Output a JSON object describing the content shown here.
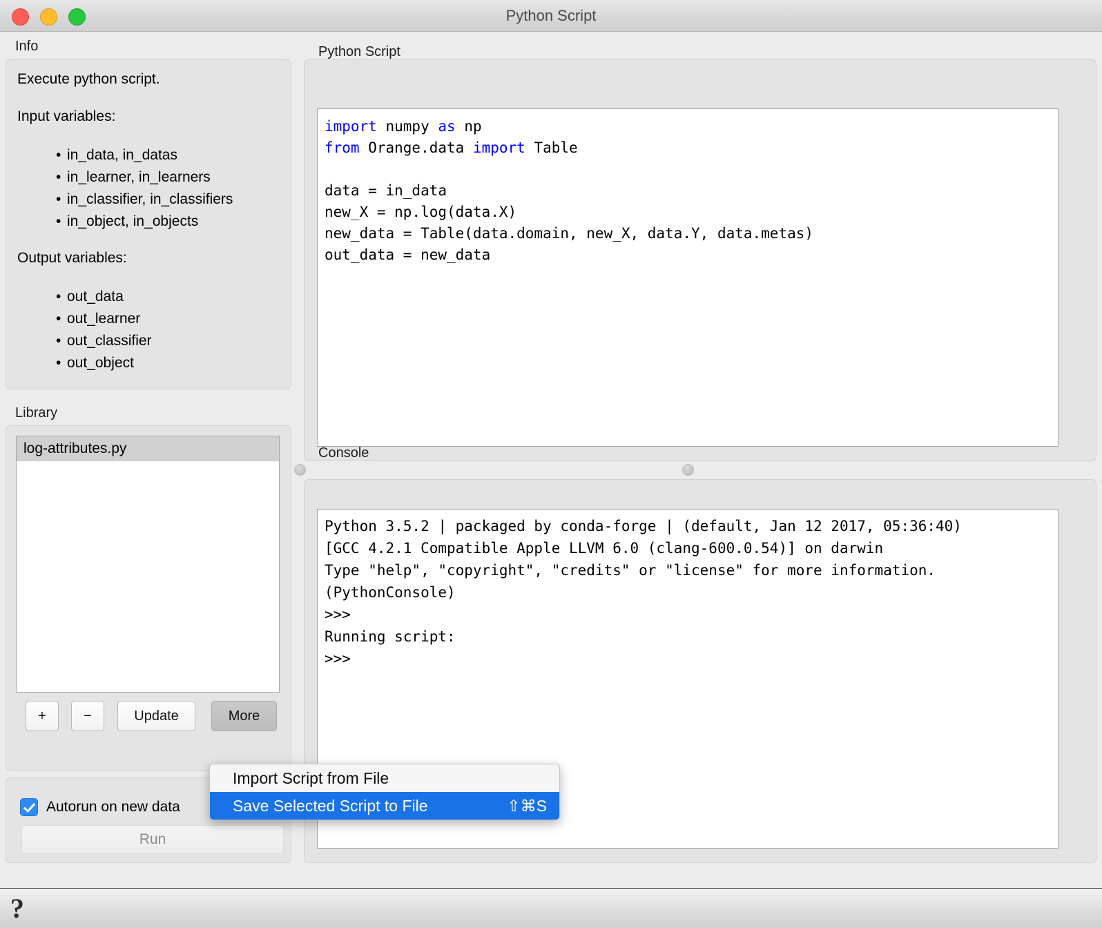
{
  "window": {
    "title": "Python Script",
    "traffic_lights": {
      "close": "close-button",
      "minimize": "minimize-button",
      "zoom": "zoom-button"
    },
    "colors": {
      "close": "#ff5f57",
      "minimize": "#febc2e",
      "zoom": "#28c840",
      "menu_highlight": "#1a72e8",
      "checkbox_accent": "#2e8bf5",
      "keyword": "#0000ff"
    }
  },
  "info": {
    "caption": "Info",
    "description": "Execute python script.",
    "input_heading": "Input variables:",
    "input_variables": [
      "in_data, in_datas",
      "in_learner, in_learners",
      "in_classifier, in_classifiers",
      "in_object, in_objects"
    ],
    "output_heading": "Output variables:",
    "output_variables": [
      "out_data",
      "out_learner",
      "out_classifier",
      "out_object"
    ]
  },
  "library": {
    "caption": "Library",
    "items": [
      {
        "name": "log-attributes.py",
        "selected": true
      }
    ],
    "buttons": {
      "add": "+",
      "remove": "−",
      "update": "Update",
      "more": "More"
    }
  },
  "more_menu": {
    "items": [
      {
        "label": "Import Script from File",
        "shortcut": "",
        "highlighted": false
      },
      {
        "label": "Save Selected Script to File",
        "shortcut": "⇧⌘S",
        "highlighted": true
      }
    ]
  },
  "run_panel": {
    "autorun_label": "Autorun on new data",
    "autorun_checked": true,
    "run_label": "Run",
    "run_enabled": false
  },
  "script_panel": {
    "caption": "Python Script",
    "code_lines": [
      {
        "segments": [
          {
            "t": "import",
            "kw": true
          },
          {
            "t": " numpy ",
            "kw": false
          },
          {
            "t": "as",
            "kw": true
          },
          {
            "t": " np",
            "kw": false
          }
        ]
      },
      {
        "segments": [
          {
            "t": "from",
            "kw": true
          },
          {
            "t": " Orange.data ",
            "kw": false
          },
          {
            "t": "import",
            "kw": true
          },
          {
            "t": " Table",
            "kw": false
          }
        ]
      },
      {
        "segments": [
          {
            "t": "",
            "kw": false
          }
        ]
      },
      {
        "segments": [
          {
            "t": "data = in_data",
            "kw": false
          }
        ]
      },
      {
        "segments": [
          {
            "t": "new_X = np.log(data.X)",
            "kw": false
          }
        ]
      },
      {
        "segments": [
          {
            "t": "new_data = Table(data.domain, new_X, data.Y, data.metas)",
            "kw": false
          }
        ]
      },
      {
        "segments": [
          {
            "t": "out_data = new_data",
            "kw": false
          }
        ]
      }
    ]
  },
  "console_panel": {
    "caption": "Console",
    "lines": [
      "Python 3.5.2 | packaged by conda-forge | (default, Jan 12 2017, 05:36:40)",
      "[GCC 4.2.1 Compatible Apple LLVM 6.0 (clang-600.0.54)] on darwin",
      "Type \"help\", \"copyright\", \"credits\" or \"license\" for more information.",
      "(PythonConsole)",
      ">>>",
      "Running script:",
      ">>>"
    ]
  },
  "status_bar": {
    "help_icon_glyph": "?"
  }
}
